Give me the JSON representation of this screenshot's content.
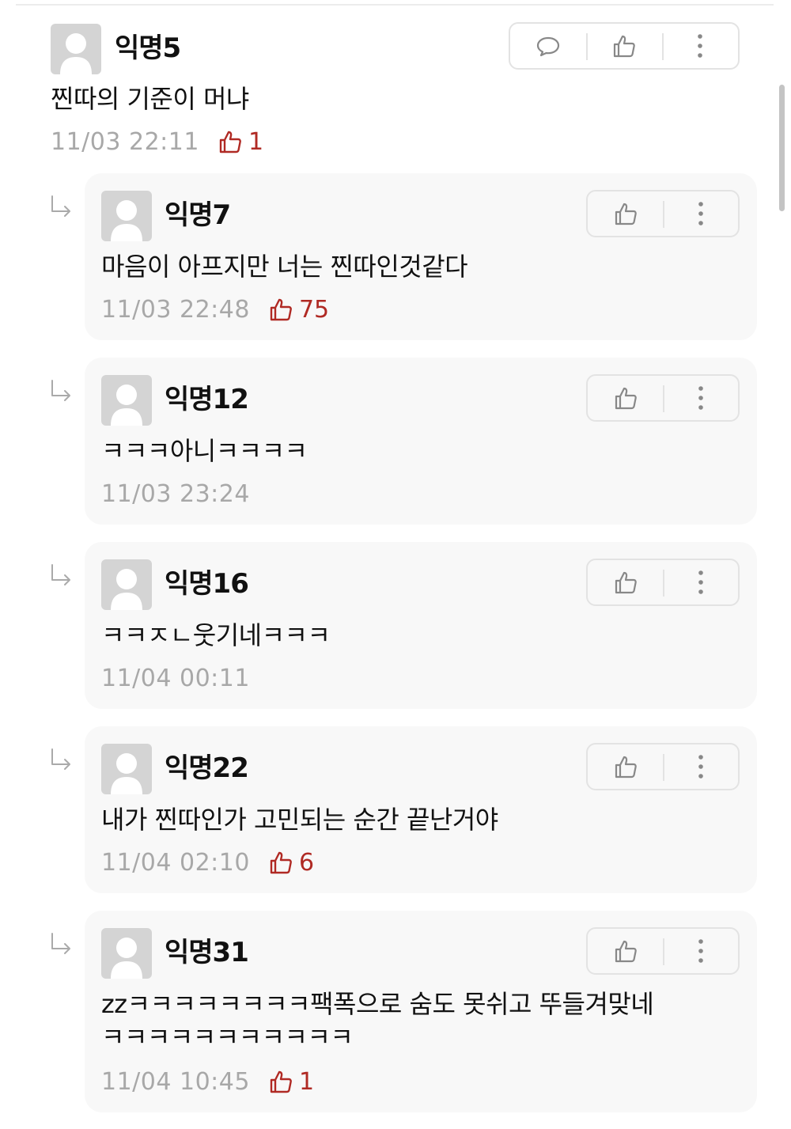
{
  "main_comment": {
    "username": "익명5",
    "text": "찐따의 기준이 머냐",
    "time": "11/03 22:11",
    "likes": "1"
  },
  "replies": [
    {
      "username": "익명7",
      "text": "마음이 아프지만 너는 찐따인것같다",
      "time": "11/03 22:48",
      "likes": "75"
    },
    {
      "username": "익명12",
      "text": "ㅋㅋㅋ아니ㅋㅋㅋㅋ",
      "time": "11/03 23:24",
      "likes": ""
    },
    {
      "username": "익명16",
      "text": "ㅋㅋㅈㄴ웃기네ㅋㅋㅋ",
      "time": "11/04 00:11",
      "likes": ""
    },
    {
      "username": "익명22",
      "text": "내가 찐따인가 고민되는 순간 끝난거야",
      "time": "11/04 02:10",
      "likes": "6"
    },
    {
      "username": "익명31",
      "text_line1": "zzㅋㅋㅋㅋㅋㅋㅋㅋ팩폭으로 숨도 못쉬고 뚜들겨맞네",
      "text_line2": "ㅋㅋㅋㅋㅋㅋㅋㅋㅋㅋㅋ",
      "time": "11/04 10:45",
      "likes": "1"
    }
  ],
  "icons": {
    "comment": "speech-bubble-icon",
    "like": "thumbs-up-icon",
    "more": "vertical-dots-icon",
    "reply": "reply-arrow-icon"
  },
  "colors": {
    "like_red": "#b02a24",
    "time_gray": "#a8a8a8",
    "reply_bg": "#f8f8f8"
  }
}
